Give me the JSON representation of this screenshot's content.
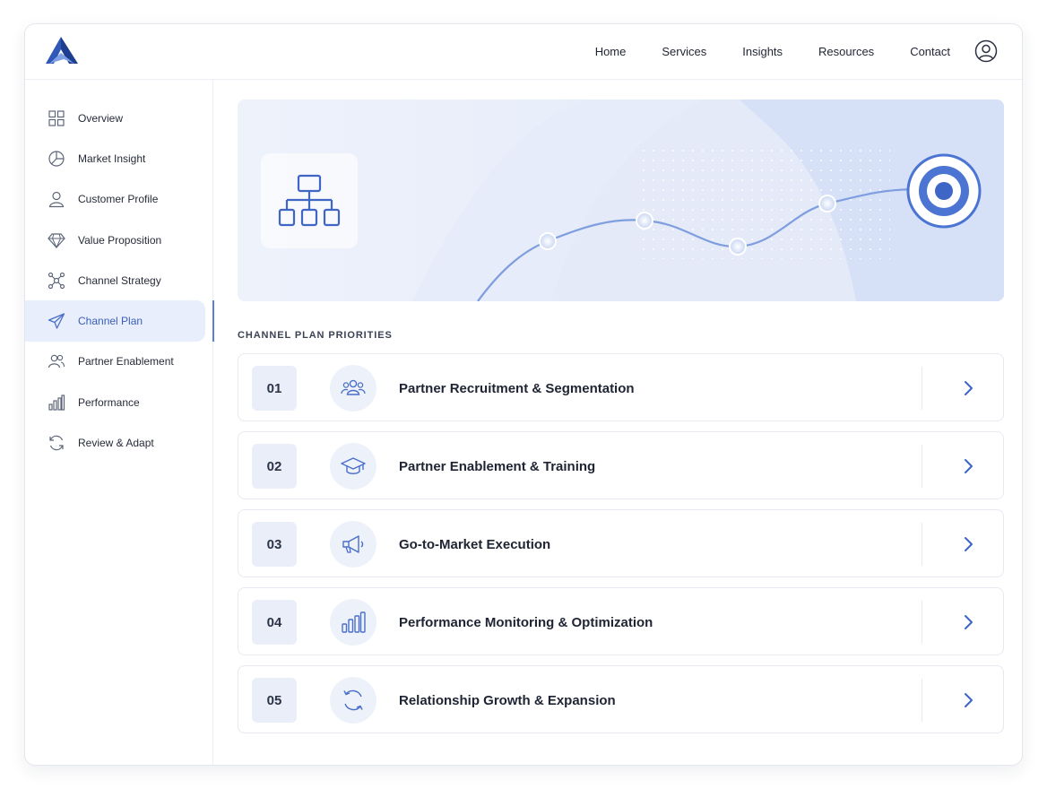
{
  "header": {
    "logo_icon": "triangle-a-logo",
    "nav": [
      "Home",
      "Services",
      "Insights",
      "Resources",
      "Contact"
    ],
    "avatar_icon": "user-circle-icon"
  },
  "sidebar": {
    "active_index": 5,
    "items": [
      {
        "label": "Overview",
        "icon": "grid-icon"
      },
      {
        "label": "Market Insight",
        "icon": "pie-chart-icon"
      },
      {
        "label": "Customer Profile",
        "icon": "user-icon"
      },
      {
        "label": "Value Proposition",
        "icon": "diamond-icon"
      },
      {
        "label": "Channel Strategy",
        "icon": "network-icon"
      },
      {
        "label": "Channel Plan",
        "icon": "paper-plane-icon"
      },
      {
        "label": "Partner Enablement",
        "icon": "users-icon"
      },
      {
        "label": "Performance",
        "icon": "bar-chart-icon"
      },
      {
        "label": "Review & Adapt",
        "icon": "refresh-icon"
      }
    ]
  },
  "hero": {
    "tile_icon": "hierarchy-icon",
    "target_icon": "target-icon"
  },
  "section_title": "CHANNEL PLAN PRIORITIES",
  "priorities": [
    {
      "number": "01",
      "title": "Partner Recruitment & Segmentation",
      "icon": "group-icon"
    },
    {
      "number": "02",
      "title": "Partner Enablement & Training",
      "icon": "graduation-cap-icon"
    },
    {
      "number": "03",
      "title": "Go-to-Market Execution",
      "icon": "megaphone-icon"
    },
    {
      "number": "04",
      "title": "Performance Monitoring & Optimization",
      "icon": "bar-chart-icon"
    },
    {
      "number": "05",
      "title": "Relationship Growth & Expansion",
      "icon": "cycle-icon"
    }
  ],
  "colors": {
    "accent": "#3a64c8",
    "accent_light": "#e8eefb",
    "text": "#1f2433",
    "border": "#e6e9f0"
  }
}
